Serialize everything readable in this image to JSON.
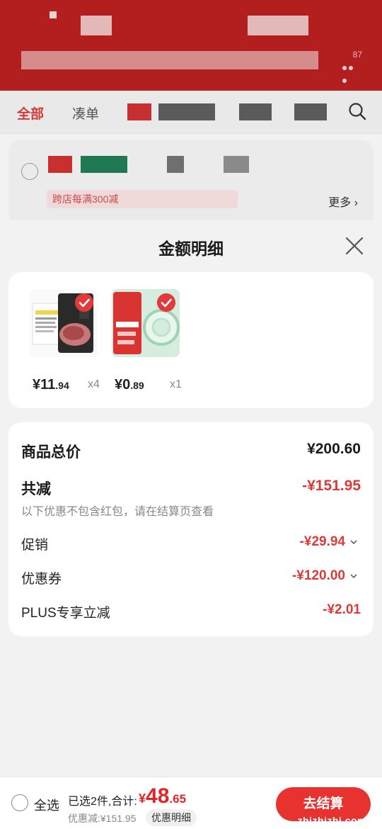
{
  "background": {
    "banner_count": "87",
    "tabs": {
      "all": "全部",
      "second": "凑单"
    },
    "store": {
      "promo": "跨店每满300减",
      "more": "更多"
    }
  },
  "sheet": {
    "title": "金额明细",
    "goods": [
      {
        "price_int": "¥11",
        "price_dec": ".94",
        "qty": "x4"
      },
      {
        "price_int": "¥0",
        "price_dec": ".89",
        "qty": "x1"
      }
    ],
    "details": {
      "total_label": "商品总价",
      "total_value": "¥200.60",
      "reduce_label": "共减",
      "reduce_value": "-¥151.95",
      "note": "以下优惠不包含红包，请在结算页查看",
      "rows": [
        {
          "label": "促销",
          "value": "-¥29.94"
        },
        {
          "label": "优惠券",
          "value": "-¥120.00"
        },
        {
          "label": "PLUS专享立减",
          "value": "-¥2.01"
        }
      ]
    }
  },
  "bottom": {
    "select_all": "全选",
    "summary": "已选2件,合计:",
    "total_sym": "¥",
    "total_int": "48",
    "total_dec": ".65",
    "saving": "优惠减:¥151.95",
    "detail_pill": "优惠明细",
    "checkout": "去结算",
    "watermark": "zhizhizhi.com"
  },
  "colors": {
    "brand_red": "#b31f1f",
    "price_red": "#e0262b",
    "discount_red": "#d93a3a"
  }
}
